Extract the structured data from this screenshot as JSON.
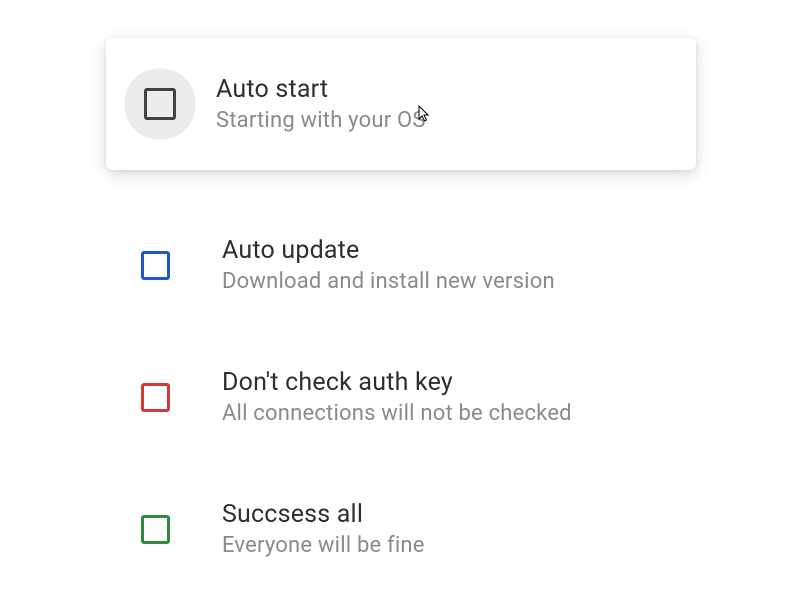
{
  "options": [
    {
      "title": "Auto start",
      "subtitle": "Starting with your OS",
      "color": "default",
      "hovered": true
    },
    {
      "title": "Auto update",
      "subtitle": "Download and install new version",
      "color": "blue",
      "hovered": false
    },
    {
      "title": "Don't check auth key",
      "subtitle": "All connections will not be checked",
      "color": "red",
      "hovered": false
    },
    {
      "title": "Succsess all",
      "subtitle": "Everyone will be fine",
      "color": "green",
      "hovered": false
    }
  ]
}
